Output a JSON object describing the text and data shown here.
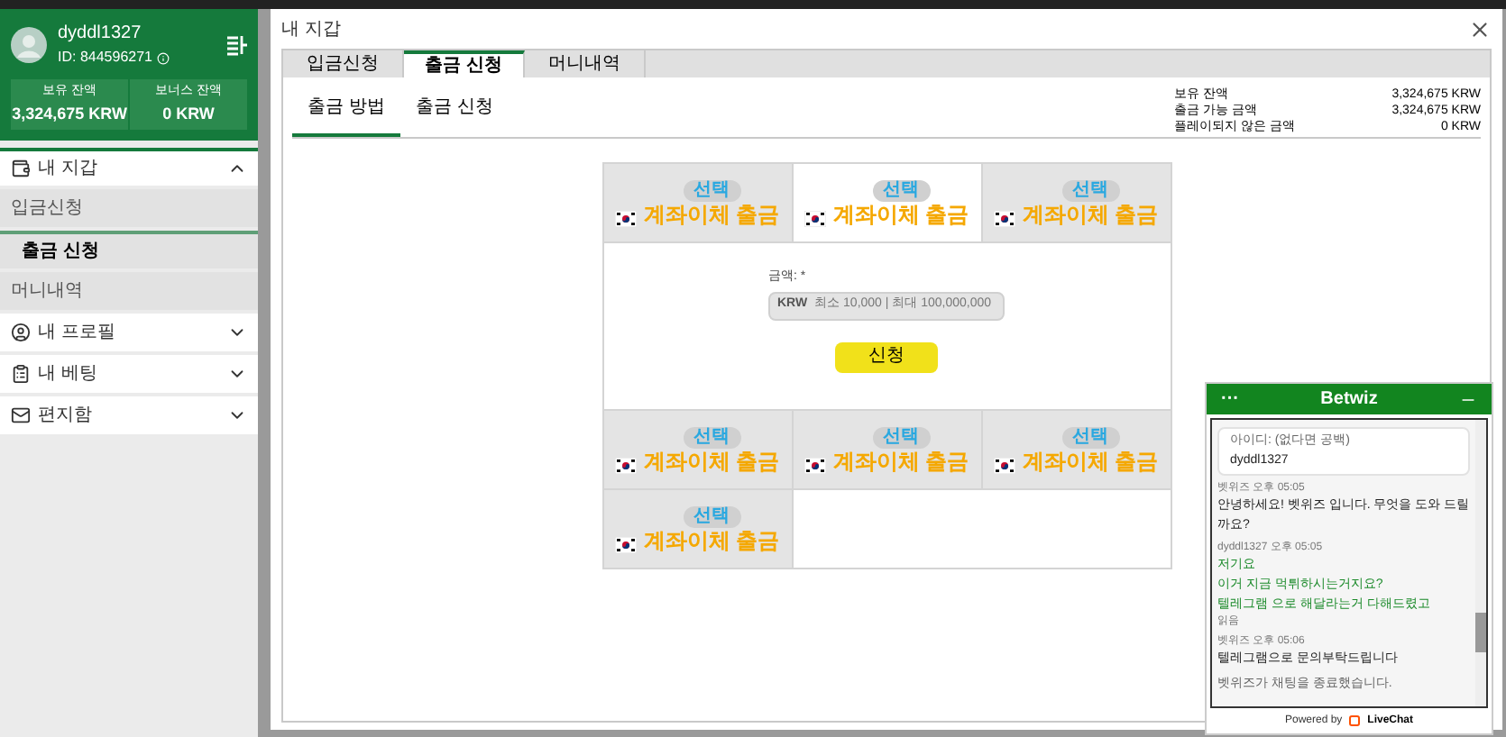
{
  "sidebar": {
    "username": "dyddl1327",
    "user_id": "ID: 844596271",
    "balances": [
      {
        "label": "보유 잔액",
        "value": "3,324,675 KRW"
      },
      {
        "label": "보너스 잔액",
        "value": "0 KRW"
      }
    ],
    "menu": [
      {
        "label": "내 지갑",
        "expanded": true,
        "children": [
          {
            "label": "입금신청",
            "selected": false
          },
          {
            "label": "출금 신청",
            "selected": true
          },
          {
            "label": "머니내역",
            "selected": false
          }
        ]
      },
      {
        "label": "내 프로필",
        "expanded": false
      },
      {
        "label": "내 베팅",
        "expanded": false
      },
      {
        "label": "편지함",
        "expanded": false
      }
    ]
  },
  "panel": {
    "title": "내 지갑",
    "tabs": [
      {
        "label": "입금신청",
        "selected": false
      },
      {
        "label": "출금 신청",
        "selected": true
      },
      {
        "label": "머니내역",
        "selected": false
      }
    ],
    "subtabs": [
      {
        "label": "출금 방법",
        "selected": true
      },
      {
        "label": "출금 신청",
        "selected": false
      }
    ],
    "summary": [
      {
        "label": "보유 잔액",
        "value": "3,324,675 KRW"
      },
      {
        "label": "출금 가능 금액",
        "value": "3,324,675 KRW"
      },
      {
        "label": "플레이되지 않은 금액",
        "value": "0 KRW"
      }
    ],
    "methods_top": [
      {
        "badge": "선택",
        "label": "계좌이체 출금",
        "selected": false
      },
      {
        "badge": "선택",
        "label": "계좌이체 출금",
        "selected": true
      },
      {
        "badge": "선택",
        "label": "계좌이체 출금",
        "selected": false
      }
    ],
    "form": {
      "label": "금액: *",
      "currency": "KRW",
      "placeholder": "최소 10,000 | 최대 100,000,000",
      "submit": "신청"
    },
    "methods_bottom": [
      {
        "badge": "선택",
        "label": "계좌이체 출금",
        "selected": false
      },
      {
        "badge": "선택",
        "label": "계좌이체 출금",
        "selected": false
      },
      {
        "badge": "선택",
        "label": "계좌이체 출금",
        "selected": false
      },
      {
        "badge": "선택",
        "label": "계좌이체 출금",
        "selected": false
      }
    ]
  },
  "chat": {
    "menu": "···",
    "title": "Betwiz",
    "id_label": "아이디: (없다면 공백)",
    "id_value": "dyddl1327",
    "messages": [
      {
        "kind": "agent",
        "meta": "벳위즈 오후 05:05",
        "lines": [
          "안녕하세요! 벳위즈 입니다. 무엇을 도와 드릴까요?"
        ]
      },
      {
        "kind": "user",
        "meta": "dyddl1327 오후 05:05",
        "lines": [
          "저기요",
          "이거 지금 먹튀하시는거지요?",
          "텔레그램 으로 해달라는거 다해드렸고"
        ],
        "status": "읽음"
      },
      {
        "kind": "agent",
        "meta": "벳위즈 오후 05:06",
        "lines": [
          "텔레그램으로 문의부탁드립니다"
        ]
      },
      {
        "kind": "system",
        "lines": [
          "벳위즈가 채팅을 종료했습니다."
        ]
      }
    ],
    "powered": "Powered by",
    "brand": "LiveChat"
  }
}
